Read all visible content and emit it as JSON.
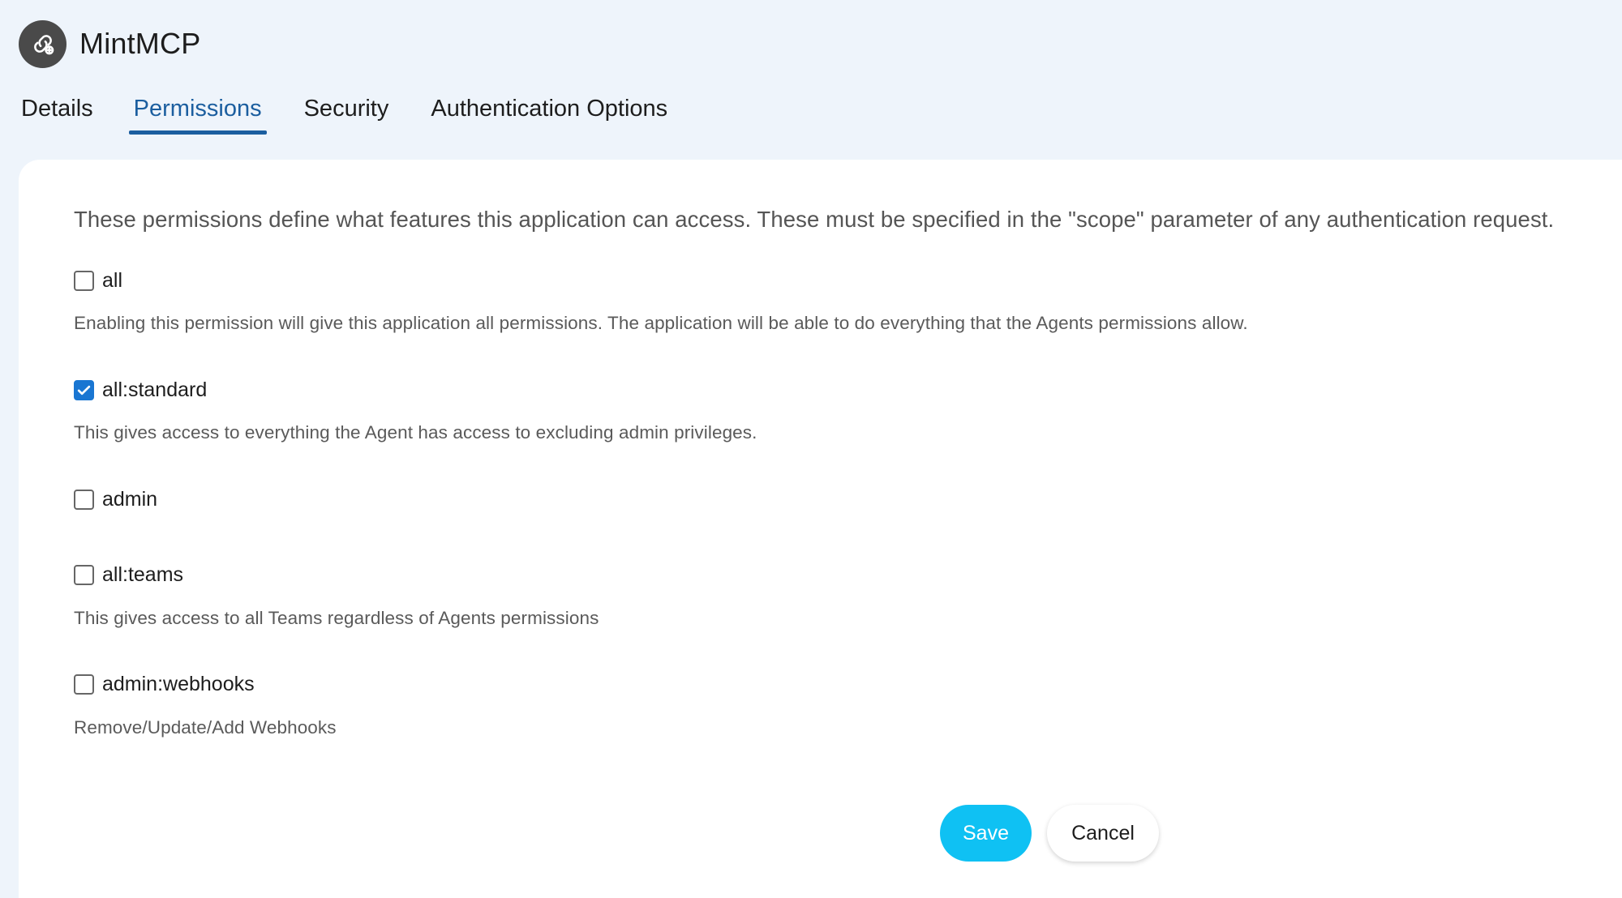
{
  "app": {
    "title": "MintMCP",
    "icon": "link-gear-icon"
  },
  "tabs": [
    {
      "label": "Details",
      "active": false
    },
    {
      "label": "Permissions",
      "active": true
    },
    {
      "label": "Security",
      "active": false
    },
    {
      "label": "Authentication Options",
      "active": false
    }
  ],
  "permissions": {
    "intro": "These permissions define what features this application can access. These must be specified in the \"scope\" parameter of any authentication request.",
    "items": [
      {
        "name": "all",
        "checked": false,
        "description": "Enabling this permission will give this application all permissions. The application will be able to do everything that the Agents permissions allow."
      },
      {
        "name": "all:standard",
        "checked": true,
        "description": "This gives access to everything the Agent has access to excluding admin privileges."
      },
      {
        "name": "admin",
        "checked": false,
        "description": ""
      },
      {
        "name": "all:teams",
        "checked": false,
        "description": "This gives access to all Teams regardless of Agents permissions"
      },
      {
        "name": "admin:webhooks",
        "checked": false,
        "description": "Remove/Update/Add Webhooks"
      }
    ]
  },
  "actions": {
    "save_label": "Save",
    "cancel_label": "Cancel"
  },
  "colors": {
    "accent": "#1b5e9f",
    "save_button": "#0fc1f3",
    "checkbox_checked": "#1976d2",
    "background": "#eef4fb"
  }
}
